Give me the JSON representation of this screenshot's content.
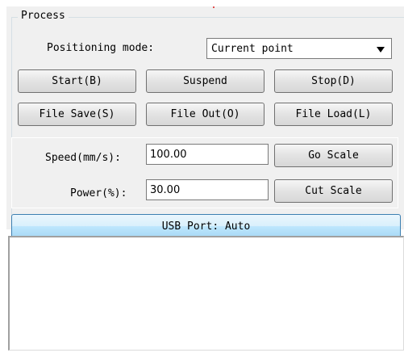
{
  "group": {
    "title": "Process"
  },
  "positioning": {
    "label": "Positioning mode:",
    "selected": "Current point"
  },
  "buttons": {
    "start": "Start(B)",
    "suspend": "Suspend",
    "stop": "Stop(D)",
    "file_save": "File Save(S)",
    "file_out": "File Out(O)",
    "file_load": "File Load(L)",
    "go_scale": "Go Scale",
    "cut_scale": "Cut Scale"
  },
  "speed": {
    "label": "Speed(mm/s):",
    "value": "100.00"
  },
  "power": {
    "label": "Power(%):",
    "value": "30.00"
  },
  "usb": {
    "label": "USB Port: Auto"
  }
}
